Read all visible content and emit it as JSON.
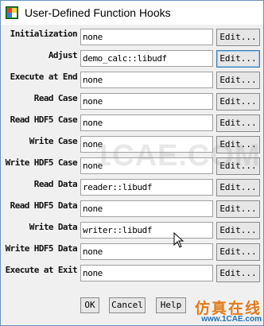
{
  "window": {
    "title": "User-Defined Function Hooks",
    "icon": "fluent-app-icon"
  },
  "hooks": [
    {
      "label": "Initialization",
      "value": "none",
      "edit": "Edit..."
    },
    {
      "label": "Adjust",
      "value": "demo_calc::libudf",
      "edit": "Edit..."
    },
    {
      "label": "Execute at End",
      "value": "none",
      "edit": "Edit..."
    },
    {
      "label": "Read Case",
      "value": "none",
      "edit": "Edit..."
    },
    {
      "label": "Read HDF5 Case",
      "value": "none",
      "edit": "Edit..."
    },
    {
      "label": "Write Case",
      "value": "none",
      "edit": "Edit..."
    },
    {
      "label": "Write HDF5 Case",
      "value": "none",
      "edit": "Edit..."
    },
    {
      "label": "Read Data",
      "value": "reader::libudf",
      "edit": "Edit..."
    },
    {
      "label": "Read HDF5 Data",
      "value": "none",
      "edit": "Edit..."
    },
    {
      "label": "Write Data",
      "value": "writer::libudf",
      "edit": "Edit..."
    },
    {
      "label": "Write HDF5 Data",
      "value": "none",
      "edit": "Edit..."
    },
    {
      "label": "Execute at Exit",
      "value": "none",
      "edit": "Edit..."
    }
  ],
  "buttons": {
    "ok": "OK",
    "cancel": "Cancel",
    "help": "Help"
  },
  "watermark": {
    "text": "1CAE.COM",
    "brand_cn": "仿真在线",
    "brand_url": "www.1CAE.com"
  }
}
